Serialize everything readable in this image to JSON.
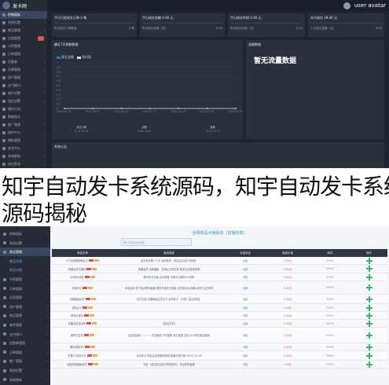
{
  "top": {
    "logo_text": "发卡网",
    "user": "user avatar",
    "sidebar": [
      {
        "label": "控制面板",
        "active": true,
        "badge": false
      },
      {
        "label": "系统设置",
        "active": false,
        "badge": false
      },
      {
        "label": "商品管理",
        "active": false,
        "badge": false
      },
      {
        "label": "分类管理",
        "active": false,
        "badge": true
      },
      {
        "label": "卡密管理",
        "active": false,
        "badge": false
      },
      {
        "label": "订单管理",
        "active": false,
        "badge": false
      },
      {
        "label": "优惠券",
        "active": false,
        "badge": false
      },
      {
        "label": "文章管理",
        "active": false,
        "badge": false
      },
      {
        "label": "用户管理",
        "active": false,
        "badge": false
      },
      {
        "label": "支付接口",
        "active": false,
        "badge": false
      },
      {
        "label": "邮件设置",
        "active": false,
        "badge": false
      },
      {
        "label": "短信设置",
        "active": false,
        "badge": false
      },
      {
        "label": "操作日志",
        "active": false,
        "badge": false
      },
      {
        "label": "数据统计",
        "active": false,
        "badge": false
      },
      {
        "label": "推广管理",
        "active": false,
        "badge": false
      },
      {
        "label": "插件中心",
        "active": false,
        "badge": false
      },
      {
        "label": "模板管理",
        "active": false,
        "badge": false
      },
      {
        "label": "安全中心",
        "active": false,
        "badge": false
      },
      {
        "label": "系统更新",
        "active": false,
        "badge": false
      },
      {
        "label": "退出登录",
        "active": false,
        "badge": false
      }
    ],
    "stats": [
      {
        "label": "今日已经成交订单 0 笔",
        "row_left": "昨日成交订单数量",
        "row_right": "0 笔"
      },
      {
        "label": "今日成交金额 0.00 元",
        "row_left": "昨日成交金额（元）",
        "row_right": "0.00"
      },
      {
        "label": "今日成交利润 0.00 元",
        "row_left": "昨日成交利润（元）",
        "row_right": "0.00"
      },
      {
        "label": "本月成交 28.00 元",
        "row_left": "上月成交金额（元）",
        "row_right": "0.00"
      }
    ],
    "chart_panel": {
      "title": "最近7天销售数据",
      "legend": [
        {
          "name": "营业金额",
          "color": "#3b6fd4"
        },
        {
          "name": "净利润",
          "color": "#d8dbe2"
        }
      ]
    },
    "flow_panel": {
      "title": "流量数据",
      "empty": "暂无流量数据"
    },
    "totals": [
      {
        "label": "成交订单",
        "value": "0 / 0 / 0 / 0"
      },
      {
        "label": "总额",
        "value": "0.00 / 0.00"
      },
      {
        "label": "退款",
        "value": "0 / 0 / 0 / 0"
      }
    ],
    "bottom_panel_title": "系统公告"
  },
  "chart_data": {
    "type": "line",
    "title": "最近7天销售数据",
    "x": [
      "2020-04-14",
      "2020-04-15",
      "2020-04-16",
      "2020-04-17",
      "2020-04-18",
      "2020-04-19",
      "2020-04-20"
    ],
    "series": [
      {
        "name": "营业金额",
        "values": [
          0,
          0,
          0,
          0,
          0,
          0,
          0
        ]
      },
      {
        "name": "净利润",
        "values": [
          0,
          0,
          0,
          0,
          0,
          0,
          0
        ]
      }
    ],
    "yticks": [
      "1",
      "0.9",
      "0.8",
      "0.7",
      "0.6",
      "0.5",
      "0.4",
      "0.3",
      "0.2",
      "0.1",
      "0"
    ],
    "ylim": [
      0,
      1
    ],
    "grid": true,
    "legend": "top-left"
  },
  "caption": {
    "line1": "知宇自动发卡系统源码，知宇自动发卡系统",
    "line2": "源码揭秘"
  },
  "bottom": {
    "title": "全网商品对接系统（店铺列表）",
    "search_placeholder": "输入商品名称搜索",
    "sidebar": [
      {
        "label": "控制面板",
        "active": false,
        "sub": false
      },
      {
        "label": "系统设置",
        "active": false,
        "sub": false
      },
      {
        "label": "商品管理",
        "active": true,
        "sub": false
      },
      {
        "label": "商品列表",
        "active": false,
        "sub": true
      },
      {
        "label": "商品对接",
        "active": false,
        "sub": true
      },
      {
        "label": "卡密管理",
        "active": false,
        "sub": false
      },
      {
        "label": "订单管理",
        "active": false,
        "sub": false
      },
      {
        "label": "分类管理",
        "active": false,
        "sub": false
      },
      {
        "label": "用户管理",
        "active": false,
        "sub": false
      },
      {
        "label": "商品管理",
        "active": false,
        "sub": false
      },
      {
        "label": "邮件管理",
        "active": false,
        "sub": false
      },
      {
        "label": "支付接口",
        "active": false,
        "sub": false
      },
      {
        "label": "优惠券管理",
        "active": false,
        "sub": false
      },
      {
        "label": "订单管理",
        "active": false,
        "sub": false
      },
      {
        "label": "推广管理",
        "active": false,
        "sub": false
      },
      {
        "label": "其他设置",
        "active": false,
        "sub": false
      },
      {
        "label": "系统更新",
        "active": false,
        "sub": false
      }
    ],
    "headers": [
      "商品名称",
      "商品描述",
      "对接状态",
      "商品价格",
      "库存",
      "操作"
    ],
    "rows": [
      {
        "name": "4寸全周期视频会员",
        "tag": true,
        "desc": "会员有效期 1个月 自动发货 【购买后请自行查看】",
        "status": "对接",
        "price": "1.00元",
        "stock": "99999"
      },
      {
        "name": "快播会员兑换码",
        "tag": true,
        "desc": "快播会员 全网通用，兑换后立即生效 购买后请查看说明",
        "status": "对接",
        "price": "3.00元",
        "stock": "99999"
      },
      {
        "name": "QQ音乐绿钻",
        "tag": true,
        "desc": "腾讯官方充值 自动到账 请填写正确的QQ号码",
        "status": "对接",
        "price": "1.00元",
        "stock": "99999"
      },
      {
        "name": "淘宝代付",
        "tag": true,
        "desc": "本店支持 拍下后请联系客服 提供淘宝代付链接 支付成功后请确认收货 注意事项",
        "status": "对接",
        "price": "1.00元",
        "stock": "99999"
      },
      {
        "name": "迅雷超级会员",
        "tag": true,
        "desc": "官方正版 迅雷超级会员月卡 自动发卡 【卡密+激活说明】",
        "status": "对接",
        "price": "1.00元",
        "stock": "99999"
      },
      {
        "name": "游戏点卡",
        "tag": true,
        "desc": "",
        "status": "对接",
        "price": "1.00元",
        "stock": "99999"
      },
      {
        "name": "网易云音乐",
        "tag": true,
        "desc": "",
        "status": "对接",
        "price": "1.00元",
        "stock": "99999"
      },
      {
        "name": "优酷会员激活码",
        "tag": true,
        "desc": "【激活方法】",
        "status": "对接",
        "price": "1.00元",
        "stock": "99999"
      },
      {
        "name": "爱奇艺会员",
        "tag": true,
        "desc": "会员激活码 ☆☆☆ 一次性使用 不可退换 官方渠道 请在24小时内激活使用",
        "status": "对接",
        "price": "1.00元",
        "stock": "99999"
      },
      {
        "name": "腾讯视频VIP",
        "tag": true,
        "desc": "",
        "status": "对接",
        "price": "1.00元",
        "stock": "99999"
      },
      {
        "name": "芒果TV会员月卡",
        "tag": true,
        "desc": "自动发卡 购买后查看使用说明 客服在线时间 09:00-22:00",
        "status": "对接",
        "price": "1.00元",
        "stock": "99999"
      },
      {
        "name": "百度网盘超级会员",
        "tag": true,
        "desc": "卡密 【激活后请及时修改密码】 售后联系客服",
        "status": "对接",
        "price": "1.00元",
        "stock": "99999"
      }
    ]
  }
}
